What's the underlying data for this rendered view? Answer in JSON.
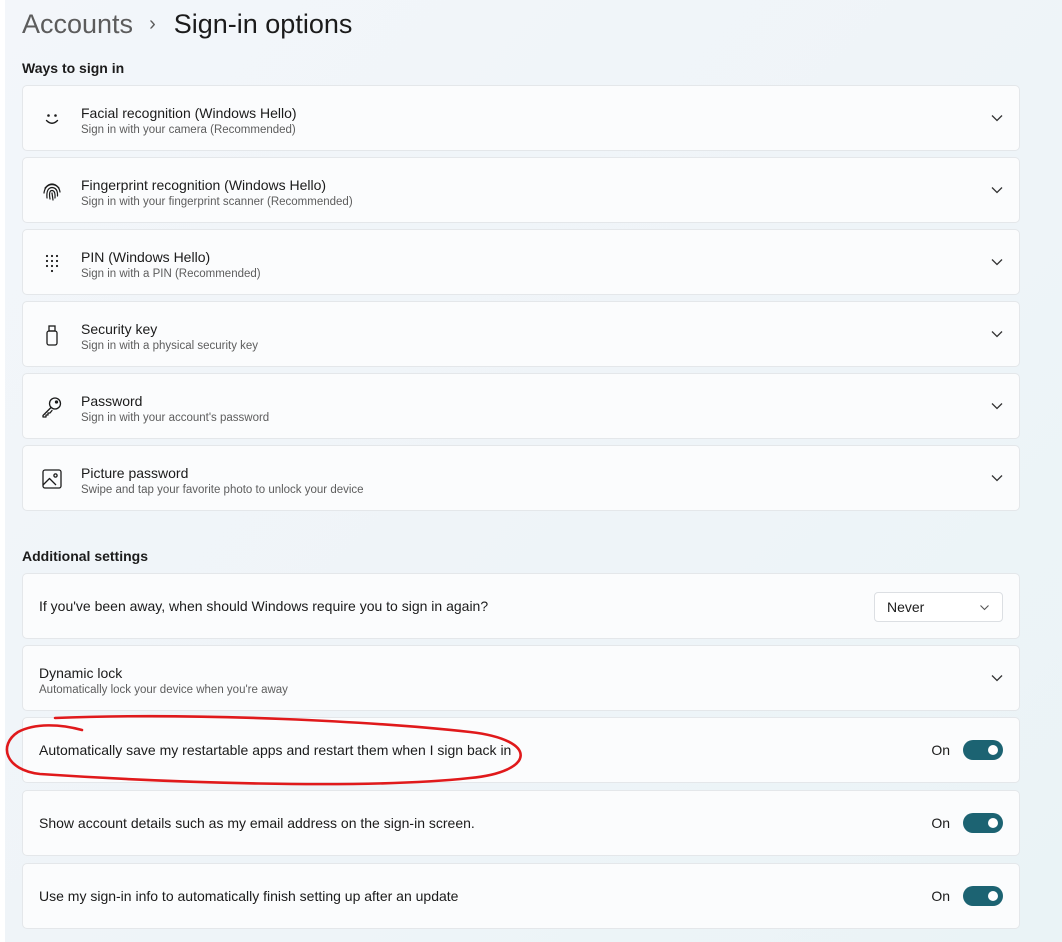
{
  "breadcrumb": {
    "parent": "Accounts",
    "separator": "›",
    "current": "Sign-in options"
  },
  "ways_section": {
    "title": "Ways to sign in",
    "items": [
      {
        "icon": "face-icon",
        "title": "Facial recognition (Windows Hello)",
        "subtitle": "Sign in with your camera (Recommended)"
      },
      {
        "icon": "fingerprint-icon",
        "title": "Fingerprint recognition (Windows Hello)",
        "subtitle": "Sign in with your fingerprint scanner (Recommended)"
      },
      {
        "icon": "pin-keypad-icon",
        "title": "PIN (Windows Hello)",
        "subtitle": "Sign in with a PIN (Recommended)"
      },
      {
        "icon": "usb-key-icon",
        "title": "Security key",
        "subtitle": "Sign in with a physical security key"
      },
      {
        "icon": "key-icon",
        "title": "Password",
        "subtitle": "Sign in with your account's password"
      },
      {
        "icon": "picture-icon",
        "title": "Picture password",
        "subtitle": "Swipe and tap your favorite photo to unlock your device"
      }
    ]
  },
  "additional_section": {
    "title": "Additional settings",
    "require_signin": {
      "label": "If you've been away, when should Windows require you to sign in again?",
      "selected": "Never"
    },
    "dynamic_lock": {
      "title": "Dynamic lock",
      "subtitle": "Automatically lock your device when you're away"
    },
    "toggles": [
      {
        "label": "Automatically save my restartable apps and restart them when I sign back in",
        "state": "On"
      },
      {
        "label": "Show account details such as my email address on the sign-in screen.",
        "state": "On"
      },
      {
        "label": "Use my sign-in info to automatically finish setting up after an update",
        "state": "On"
      }
    ]
  },
  "colors": {
    "accent": "#1c6372",
    "annotation": "#e0191b"
  }
}
